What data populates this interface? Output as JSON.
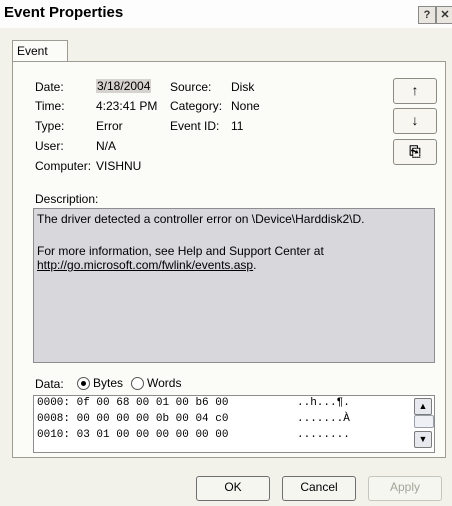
{
  "window": {
    "title": "Event Properties",
    "help_label": "?",
    "close_label": "✕"
  },
  "tab": {
    "label": "Event"
  },
  "fields": {
    "date_label": "Date:",
    "date_value": "3/18/2004",
    "time_label": "Time:",
    "time_value": "4:23:41 PM",
    "type_label": "Type:",
    "type_value": "Error",
    "user_label": "User:",
    "user_value": "N/A",
    "computer_label": "Computer:",
    "computer_value": "VISHNU",
    "source_label": "Source:",
    "source_value": "Disk",
    "category_label": "Category:",
    "category_value": "None",
    "eventid_label": "Event ID:",
    "eventid_value": "11"
  },
  "description": {
    "label": "Description:",
    "line1": "The driver detected a controller error on \\Device\\Harddisk2\\D.",
    "line2": "For more information, see Help and Support Center at",
    "link": "http://go.microsoft.com/fwlink/events.asp",
    "link_suffix": "."
  },
  "data_section": {
    "label": "Data:",
    "bytes_label": "Bytes",
    "words_label": "Words",
    "rows": [
      {
        "offset": "0000:",
        "hex": "0f 00 68 00 01 00 b6 00",
        "ascii": "..h...¶."
      },
      {
        "offset": "0008:",
        "hex": "00 00 00 00 0b 00 04 c0",
        "ascii": ".......À"
      },
      {
        "offset": "0010:",
        "hex": "03 01 00 00 00 00 00 00",
        "ascii": "........"
      }
    ]
  },
  "nav": {
    "up_icon": "↑",
    "down_icon": "↓",
    "copy_icon": "⎘"
  },
  "buttons": {
    "ok": "OK",
    "cancel": "Cancel",
    "apply": "Apply"
  }
}
